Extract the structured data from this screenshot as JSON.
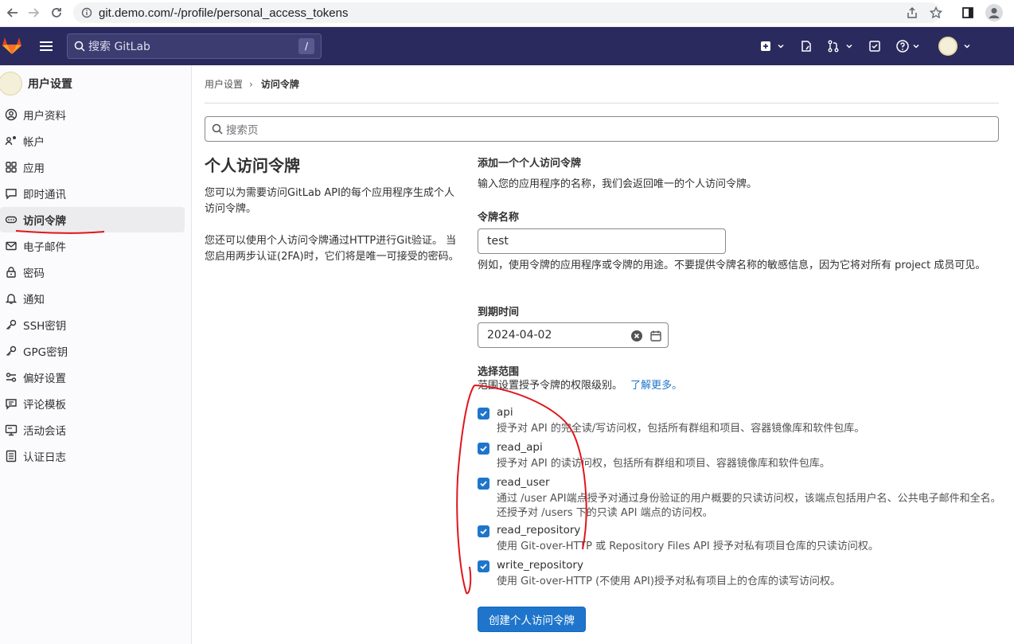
{
  "browser": {
    "url": "git.demo.com/-/profile/personal_access_tokens"
  },
  "header": {
    "search_placeholder": "搜索 GitLab",
    "search_shortcut": "/"
  },
  "sidebar": {
    "title": "用户设置",
    "items": [
      {
        "label": "用户资料",
        "icon": "user-circle-icon"
      },
      {
        "label": "帐户",
        "icon": "account-gear-icon"
      },
      {
        "label": "应用",
        "icon": "applications-icon"
      },
      {
        "label": "即时通讯",
        "icon": "chat-icon"
      },
      {
        "label": "访问令牌",
        "icon": "token-icon",
        "active": true
      },
      {
        "label": "电子邮件",
        "icon": "mail-icon"
      },
      {
        "label": "密码",
        "icon": "lock-icon"
      },
      {
        "label": "通知",
        "icon": "bell-icon"
      },
      {
        "label": "SSH密钥",
        "icon": "key-icon"
      },
      {
        "label": "GPG密钥",
        "icon": "key-icon"
      },
      {
        "label": "偏好设置",
        "icon": "preferences-icon"
      },
      {
        "label": "评论模板",
        "icon": "comment-icon"
      },
      {
        "label": "活动会话",
        "icon": "monitor-icon"
      },
      {
        "label": "认证日志",
        "icon": "log-icon"
      }
    ]
  },
  "breadcrumb": {
    "parent": "用户设置",
    "current": "访问令牌"
  },
  "page_search_placeholder": "搜索页",
  "intro": {
    "title": "个人访问令牌",
    "p1": "您可以为需要访问GitLab API的每个应用程序生成个人访问令牌。",
    "p2": "您还可以使用个人访问令牌通过HTTP进行Git验证。 当您启用两步认证(2FA)时，它们将是唯一可接受的密码。"
  },
  "form": {
    "heading": "添加一个个人访问令牌",
    "subheading": "输入您的应用程序的名称，我们会返回唯一的个人访问令牌。",
    "name_label": "令牌名称",
    "name_value": "test",
    "name_help": "例如，使用令牌的应用程序或令牌的用途。不要提供令牌名称的敏感信息，因为它将对所有 project 成员可见。",
    "expiry_label": "到期时间",
    "expiry_value": "2024-04-02",
    "scopes_label": "选择范围",
    "scopes_help": "范围设置授予令牌的权限级别。",
    "scopes_link": "了解更多。",
    "scopes": [
      {
        "name": "api",
        "desc": "授予对 API 的完全读/写访问权，包括所有群组和项目、容器镜像库和软件包库。",
        "checked": true
      },
      {
        "name": "read_api",
        "desc": "授予对 API 的读访问权，包括所有群组和项目、容器镜像库和软件包库。",
        "checked": true
      },
      {
        "name": "read_user",
        "desc": "通过 /user API端点授予对通过身份验证的用户概要的只读访问权，该端点包括用户名、公共电子邮件和全名。还授予对 /users 下的只读 API 端点的访问权。",
        "checked": true
      },
      {
        "name": "read_repository",
        "desc": "使用 Git-over-HTTP 或 Repository Files API 授予对私有项目仓库的只读访问权。",
        "checked": true
      },
      {
        "name": "write_repository",
        "desc": "使用 Git-over-HTTP (不使用 API)授予对私有项目上的仓库的读写访问权。",
        "checked": true
      }
    ],
    "submit": "创建个人访问令牌"
  },
  "colors": {
    "header_bg": "#2b2a5e",
    "primary": "#1f75cb",
    "annotation_red": "#e0161c"
  }
}
